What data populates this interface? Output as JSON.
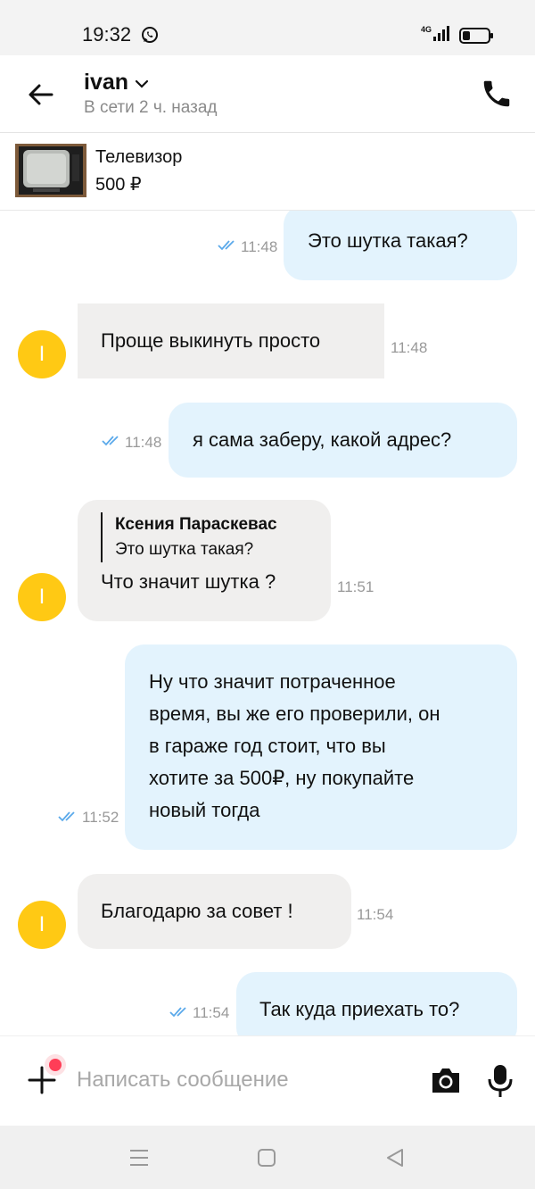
{
  "status_bar": {
    "time": "19:32",
    "network": "4G"
  },
  "header": {
    "contact_name": "ivan",
    "status": "В сети 2 ч. назад"
  },
  "product": {
    "title": "Телевизор",
    "price": "500 ₽"
  },
  "avatar_letter": "I",
  "messages": [
    {
      "direction": "out",
      "text": "Это шутка такая?",
      "time": "11:48",
      "read": true
    },
    {
      "direction": "in",
      "text": "Проще выкинуть просто",
      "time": "11:48"
    },
    {
      "direction": "out",
      "text": "я сама заберу, какой адрес?",
      "time": "11:48",
      "read": true
    },
    {
      "direction": "in",
      "quote_author": "Ксения Параскевас",
      "quote_text": "Это шутка такая?",
      "text": "Что значит шутка ?",
      "time": "11:51"
    },
    {
      "direction": "out",
      "lines": [
        "Ну что значит потраченное",
        "время, вы же его проверили, он",
        "в гараже год стоит, что вы",
        "хотите за 500₽, ну покупайте",
        "новый тогда"
      ],
      "time": "11:52",
      "read": true
    },
    {
      "direction": "in",
      "text": "Благодарю за совет !",
      "time": "11:54"
    },
    {
      "direction": "out",
      "text": "Так куда приехать то?",
      "time": "11:54",
      "read": true
    }
  ],
  "input": {
    "placeholder": "Написать сообщение",
    "value": ""
  },
  "colors": {
    "outgoing_bubble": "#e3f3fd",
    "incoming_bubble": "#f0efee",
    "avatar": "#ffc914",
    "read_ticks": "#5aa9ea",
    "notification_dot": "#ff3d57"
  },
  "icons": [
    "whatsapp-icon",
    "network-signal-icon",
    "battery-icon",
    "back-arrow-icon",
    "chevron-down-icon",
    "phone-icon",
    "plus-icon",
    "camera-icon",
    "microphone-icon",
    "double-check-icon",
    "nav-menu-icon",
    "nav-home-icon",
    "nav-back-icon"
  ]
}
